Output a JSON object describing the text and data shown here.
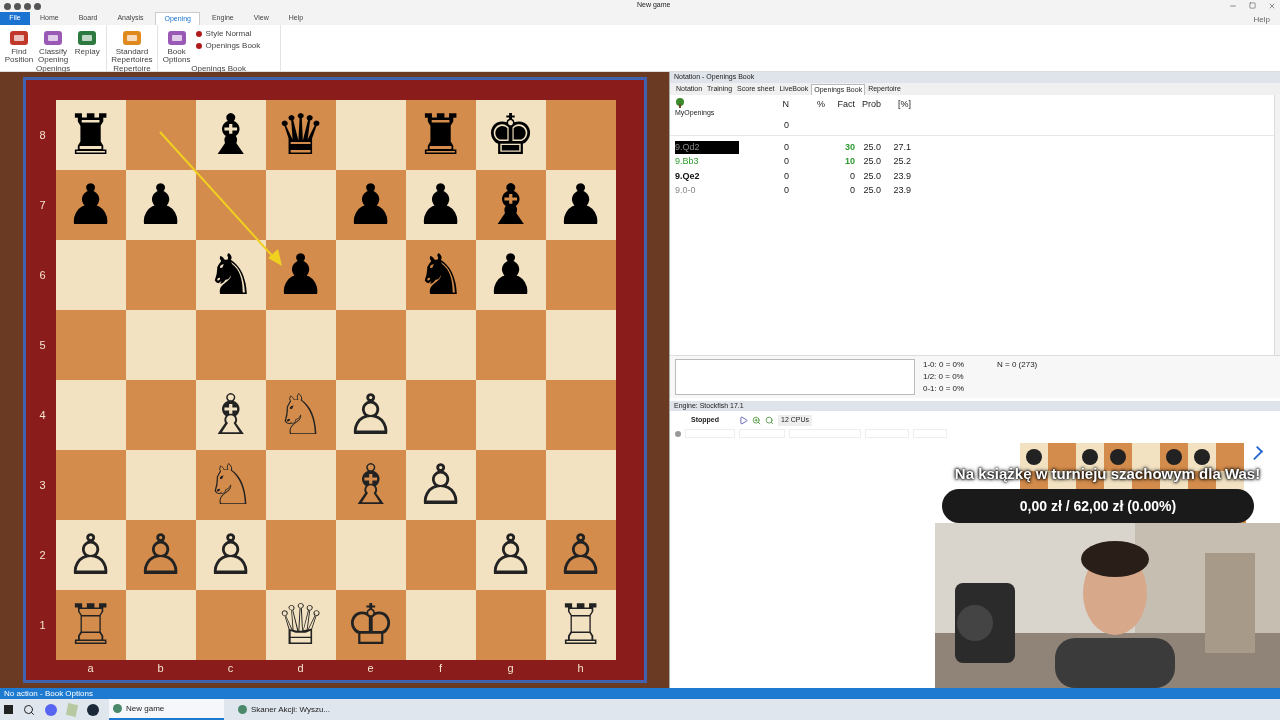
{
  "window": {
    "title": "New game",
    "help": "Help"
  },
  "ribbon": {
    "tabs": [
      {
        "label": "File",
        "selected": false,
        "kind": "file"
      },
      {
        "label": "Home",
        "selected": false,
        "kind": "tab"
      },
      {
        "label": "Board",
        "selected": false,
        "kind": "tab"
      },
      {
        "label": "Analysis",
        "selected": false,
        "kind": "tab"
      },
      {
        "label": "Opening",
        "selected": true,
        "kind": "tab"
      },
      {
        "label": "Engine",
        "selected": false,
        "kind": "tab"
      },
      {
        "label": "View",
        "selected": false,
        "kind": "tab"
      },
      {
        "label": "Help",
        "selected": false,
        "kind": "tab"
      }
    ],
    "groups": [
      {
        "label": "Openings",
        "buttons": [
          [
            "Find",
            "Position"
          ],
          [
            "Classify",
            "Opening"
          ],
          [
            "Replay"
          ]
        ]
      },
      {
        "label": "Repertoire",
        "buttons": [
          [
            "Standard",
            "Repertoires"
          ]
        ]
      },
      {
        "label": "Openings Book",
        "buttons": [
          [
            "Book",
            "Options"
          ]
        ],
        "dropdowns": [
          "Style Normal",
          "Openings Book"
        ]
      }
    ]
  },
  "board": {
    "ranks": [
      "8",
      "7",
      "6",
      "5",
      "4",
      "3",
      "2",
      "1"
    ],
    "files": [
      "a",
      "b",
      "c",
      "d",
      "e",
      "f",
      "g",
      "h"
    ],
    "squares": [
      [
        {
          "glyph": "♜"
        },
        {
          "empty": true
        },
        {
          "glyph": "♝"
        },
        {
          "glyph": "♛"
        },
        {
          "empty": true
        },
        {
          "glyph": "♜"
        },
        {
          "glyph": "♚"
        },
        {
          "empty": true
        }
      ],
      [
        {
          "glyph": "♟"
        },
        {
          "glyph": "♟"
        },
        {
          "empty": true
        },
        {
          "empty": true
        },
        {
          "glyph": "♟"
        },
        {
          "glyph": "♟"
        },
        {
          "glyph": "♝"
        },
        {
          "glyph": "♟"
        }
      ],
      [
        {
          "empty": true
        },
        {
          "empty": true
        },
        {
          "glyph": "♞"
        },
        {
          "glyph": "♟"
        },
        {
          "empty": true
        },
        {
          "glyph": "♞"
        },
        {
          "glyph": "♟"
        },
        {
          "empty": true
        }
      ],
      [
        {
          "empty": true
        },
        {
          "empty": true
        },
        {
          "empty": true
        },
        {
          "empty": true
        },
        {
          "empty": true
        },
        {
          "empty": true
        },
        {
          "empty": true
        },
        {
          "empty": true
        }
      ],
      [
        {
          "empty": true
        },
        {
          "empty": true
        },
        {
          "glyph": "♗"
        },
        {
          "glyph": "♘"
        },
        {
          "glyph": "♙"
        },
        {
          "empty": true
        },
        {
          "empty": true
        },
        {
          "empty": true
        }
      ],
      [
        {
          "empty": true
        },
        {
          "empty": true
        },
        {
          "glyph": "♘"
        },
        {
          "empty": true
        },
        {
          "glyph": "♗"
        },
        {
          "glyph": "♙"
        },
        {
          "empty": true
        },
        {
          "empty": true
        }
      ],
      [
        {
          "glyph": "♙"
        },
        {
          "glyph": "♙"
        },
        {
          "glyph": "♙"
        },
        {
          "empty": true
        },
        {
          "empty": true
        },
        {
          "empty": true
        },
        {
          "glyph": "♙"
        },
        {
          "glyph": "♙"
        }
      ],
      [
        {
          "glyph": "♖"
        },
        {
          "empty": true
        },
        {
          "empty": true
        },
        {
          "glyph": "♕"
        },
        {
          "glyph": "♔"
        },
        {
          "empty": true
        },
        {
          "empty": true
        },
        {
          "glyph": "♖"
        }
      ]
    ]
  },
  "notation": {
    "title": "Notation - Openings Book",
    "tabs": [
      {
        "label": "Notation",
        "selected": false
      },
      {
        "label": "Training",
        "selected": false
      },
      {
        "label": "Score sheet",
        "selected": false
      },
      {
        "label": "LiveBook",
        "selected": false
      },
      {
        "label": "Openings Book",
        "selected": true
      },
      {
        "label": "Repertoire",
        "selected": false
      }
    ],
    "book_name": "MyOpenings",
    "columns": [
      "N",
      "%",
      "Fact",
      "Prob",
      "[%]"
    ],
    "total_n": "0",
    "rows": [
      {
        "move": "9.Qd2",
        "n": "0",
        "fact": "30",
        "prob": "25.0",
        "pct": "27.1",
        "selected": true,
        "kind": "muted",
        "fact_highlight": true
      },
      {
        "move": "9.Bb3",
        "n": "0",
        "fact": "10",
        "prob": "25.0",
        "pct": "25.2",
        "selected": false,
        "kind": "good",
        "fact_highlight": true
      },
      {
        "move": "9.Qe2",
        "n": "0",
        "fact": "0",
        "prob": "25.0",
        "pct": "23.9",
        "selected": false,
        "kind": "main",
        "fact_highlight": false
      },
      {
        "move": "9.0-0",
        "n": "0",
        "fact": "0",
        "prob": "25.0",
        "pct": "23.9",
        "selected": false,
        "kind": "muted",
        "fact_highlight": false
      }
    ],
    "stats": [
      "1-0: 0 = 0%",
      "1/2: 0 = 0%",
      "0-1: 0 = 0%"
    ],
    "n_total": "N = 0 (273)"
  },
  "engine": {
    "title": "Engine: Stockfish 17.1",
    "status": "Stopped",
    "cpus": "12 CPUs"
  },
  "overlay": {
    "message": "Na książkę w turnieju szachowym dla Was!",
    "goal": "0,00 zł / 62,00 zł (0.00%)"
  },
  "status_bar": "No action - Book Options",
  "taskbar": [
    {
      "label": "New game",
      "selected": true
    },
    {
      "label": "Skaner Akcji: Wyszu...",
      "selected": false
    }
  ]
}
